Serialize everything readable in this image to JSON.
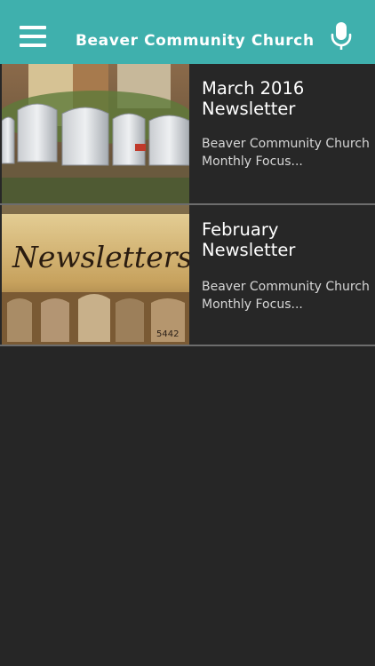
{
  "header": {
    "title": "Beaver Community Church",
    "menu_icon": "hamburger-menu-icon",
    "mic_icon": "microphone-icon"
  },
  "items": [
    {
      "title": "March 2016 Newsletter",
      "description": "Beaver Community Church Monthly Focus...",
      "image": "row of mailboxes"
    },
    {
      "title": "February Newsletter",
      "description": "Beaver Community Church Monthly Focus...",
      "image": "newsletters graphic with mailboxes",
      "image_text": "Newsletters",
      "mailbox_number": "5442"
    }
  ],
  "colors": {
    "header": "#3fb0ad",
    "background": "#262626",
    "divider": "#6d6d6d"
  }
}
